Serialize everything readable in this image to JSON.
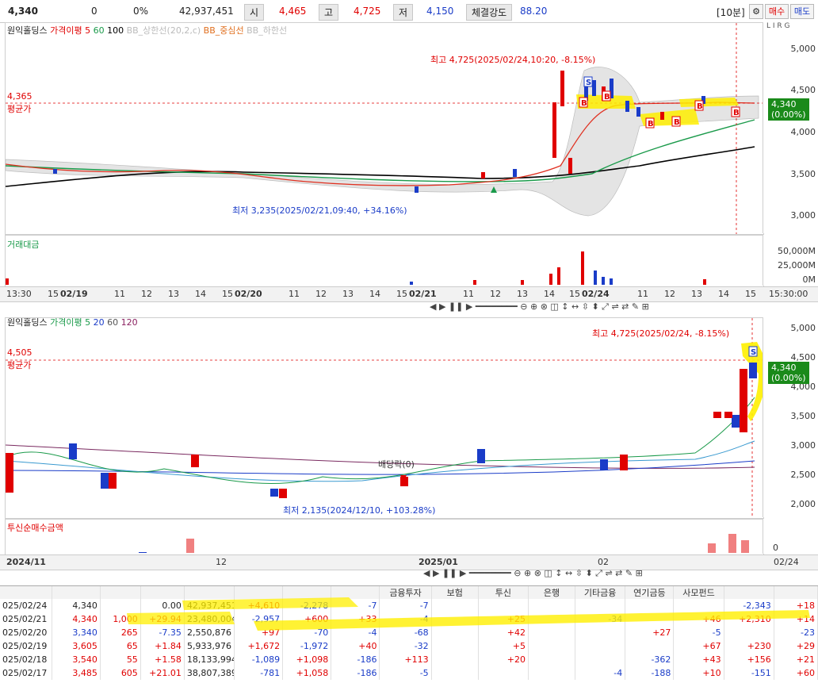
{
  "header": {
    "price": "4,340",
    "change": "0",
    "change_pct": "0%",
    "volume": "42,937,451",
    "open_label": "시",
    "open": "4,465",
    "high_label": "고",
    "high": "4,725",
    "low_label": "저",
    "low": "4,150",
    "strength_label": "체결강도",
    "strength": "88.20",
    "interval": "[10분]",
    "buy_label": "매수",
    "sell_label": "매도"
  },
  "top_chart": {
    "legend_name": "원익홀딩스",
    "legend_ma": "가격이평 5",
    "legend_ma20": "60",
    "legend_ma60": "100",
    "legend_bb_upper": "BB_상한선(20,2,c)",
    "legend_bb_mid": "BB_중심선",
    "legend_bb_lower": "BB_하한선",
    "avg_value": "4,365",
    "avg_label": "평균가",
    "high_note": "최고 4,725(2025/02/24,10:20, -8.15%)",
    "low_note": "최저 3,235(2025/02/21,09:40, +34.16%)",
    "price_tag": "4,340",
    "price_tag_pct": "(0.00%)",
    "y_ticks": [
      "5,000",
      "4,500",
      "4,000",
      "3,500",
      "3,000"
    ],
    "flags": "L I R G"
  },
  "volume_panel": {
    "legend": "거래대금",
    "y_ticks": [
      "50,000M",
      "25,000M",
      "0M"
    ]
  },
  "top_xaxis": {
    "ticks": [
      "13:30",
      "15",
      "02/19",
      "11",
      "12",
      "13",
      "14",
      "15",
      "02/20",
      "11",
      "12",
      "13",
      "14",
      "15",
      "02/21",
      "11",
      "12",
      "13",
      "14",
      "15",
      "02/24",
      "11",
      "12",
      "13",
      "14",
      "15",
      "15:30:00"
    ]
  },
  "bottom_chart": {
    "legend_name": "원익홀딩스",
    "legend_ma": "가격이평 5",
    "legend_ma20": "20",
    "legend_ma60": "60",
    "legend_ma120": "120",
    "avg_value": "4,505",
    "avg_label": "평균가",
    "high_note": "최고 4,725(2025/02/24, -8.15%)",
    "low_note": "최저 2,135(2024/12/10, +103.28%)",
    "dividend_note": "배당락(0)",
    "price_tag": "4,340",
    "price_tag_pct": "(0.00%)",
    "y_ticks": [
      "5,000",
      "4,500",
      "4,000",
      "3,500",
      "3,000",
      "2,500",
      "2,000"
    ]
  },
  "trust_panel": {
    "legend": "투신순매수금액",
    "y_ticks": [
      "0"
    ]
  },
  "bottom_xaxis": {
    "ticks": [
      "2024/11",
      "12",
      "2025/01",
      "02",
      "02/24"
    ]
  },
  "table": {
    "headers": [
      "",
      "",
      "",
      "",
      "",
      "",
      "",
      "",
      "금융투자",
      "보험",
      "투신",
      "은행",
      "기타금융",
      "연기금등",
      "사모펀드",
      "",
      ""
    ],
    "rows": [
      [
        "025/02/24",
        "4,340",
        "",
        "0.00",
        "42,937,451",
        "+4,610",
        "-2,278",
        "-7",
        "-7",
        "",
        "",
        "",
        "",
        "",
        "",
        "-2,343",
        "+18"
      ],
      [
        "025/02/21",
        "4,340",
        "1,000",
        "+29.94",
        "23,480,004",
        "-2,957",
        "+600",
        "+33",
        "-4",
        "",
        "+25",
        "",
        "-34",
        "",
        "+46",
        "+2,310",
        "+14"
      ],
      [
        "025/02/20",
        "3,340",
        "265",
        "-7.35",
        "2,550,876",
        "+97",
        "-70",
        "-4",
        "-68",
        "",
        "+42",
        "",
        "",
        "+27",
        "-5",
        "",
        "-23"
      ],
      [
        "025/02/19",
        "3,605",
        "65",
        "+1.84",
        "5,933,976",
        "+1,672",
        "-1,972",
        "+40",
        "-32",
        "",
        "+5",
        "",
        "",
        "",
        "+67",
        "+230",
        "+29"
      ],
      [
        "025/02/18",
        "3,540",
        "55",
        "+1.58",
        "18,133,994",
        "-1,089",
        "+1,098",
        "-186",
        "+113",
        "",
        "+20",
        "",
        "",
        "-362",
        "+43",
        "+156",
        "+21"
      ],
      [
        "025/02/17",
        "3,485",
        "605",
        "+21.01",
        "38,807,389",
        "-781",
        "+1,058",
        "-186",
        "-5",
        "",
        "",
        "",
        "-4",
        "-188",
        "+10",
        "-151",
        "+60"
      ]
    ]
  },
  "colors": {
    "up": "#e00000",
    "down": "#1a3cc8",
    "highlight": "#ffef00",
    "price_tag": "#1a8a1a"
  }
}
